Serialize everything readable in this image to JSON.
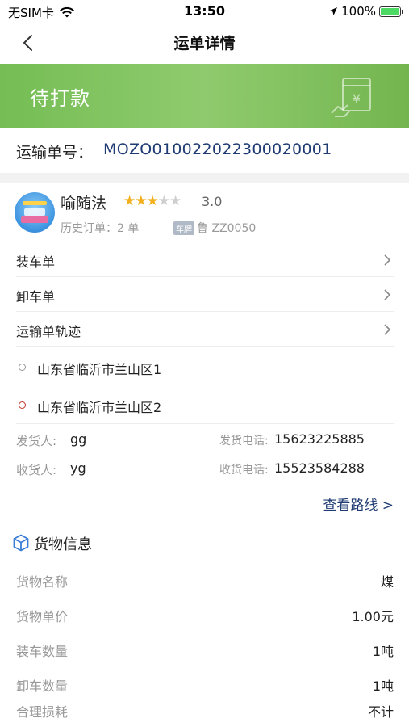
{
  "status_bar": {
    "carrier": "无SIM卡",
    "time": "13:50",
    "battery": "100%",
    "battery_level": 1.0
  },
  "nav": {
    "title": "运单详情",
    "back_icon": "chevron-left-icon"
  },
  "banner": {
    "status": "待打款",
    "icon": "invoice-yen-icon"
  },
  "waybill": {
    "label": "运输单号：",
    "number": "MOZO010022022300020001"
  },
  "driver": {
    "name": "喻随法",
    "rating": 3.0,
    "rating_max": 5,
    "score": "3.0",
    "history": "历史订单：2 单",
    "plate_tag": "车牌",
    "plate": "鲁 ZZ0050"
  },
  "links": [
    {
      "label": "装车单"
    },
    {
      "label": "卸车单"
    },
    {
      "label": "运输单轨迹"
    }
  ],
  "route": {
    "origin": "山东省临沂市兰山区1",
    "destination": "山东省临沂市兰山区2"
  },
  "contacts": {
    "shipper_label": "发货人:",
    "shipper": "gg",
    "shipper_phone_label": "发货电话:",
    "shipper_phone": "15623225885",
    "receiver_label": "收货人:",
    "receiver": "yg",
    "receiver_phone_label": "收货电话:",
    "receiver_phone": "15523584288"
  },
  "view_route": "查看路线 >",
  "goods": {
    "title": "货物信息",
    "items": [
      {
        "key": "货物名称",
        "value": "煤"
      },
      {
        "key": "货物单价",
        "value": "1.00元"
      },
      {
        "key": "装车数量",
        "value": "1吨"
      },
      {
        "key": "卸车数量",
        "value": "1吨"
      },
      {
        "key": "合理损耗",
        "value": "不计"
      }
    ]
  },
  "colors": {
    "banner_green": "#80c45f",
    "accent_blue": "#1f3b73",
    "star": "#f2b01e"
  }
}
